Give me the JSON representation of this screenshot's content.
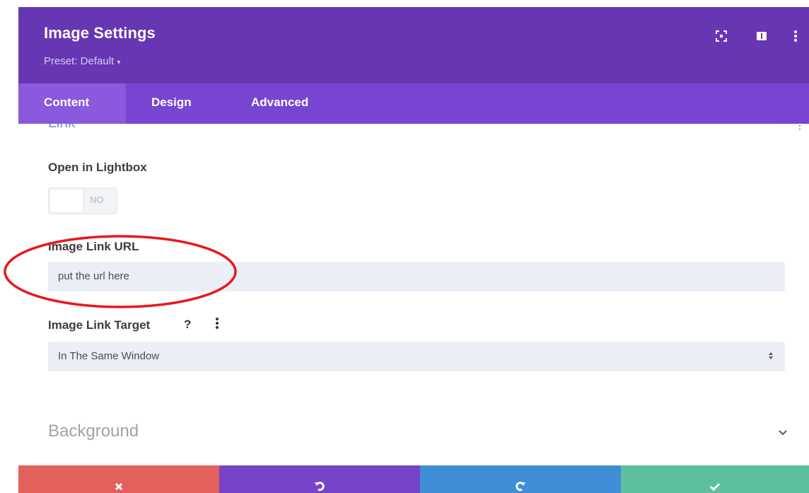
{
  "header": {
    "title": "Image Settings",
    "preset": "Preset: Default",
    "bg_color": "#6736b3"
  },
  "tabs": [
    {
      "label": "Content",
      "active": true
    },
    {
      "label": "Design",
      "active": false
    },
    {
      "label": "Advanced",
      "active": false
    }
  ],
  "sections": {
    "link_title": "Link",
    "background_title": "Background"
  },
  "fields": {
    "lightbox_label": "Open in Lightbox",
    "lightbox_value": "NO",
    "url_label": "Image Link URL",
    "url_value": "put the url here",
    "target_label": "Image Link Target",
    "target_value": "In The Same Window",
    "target_help": "?"
  },
  "annotation": {
    "shape": "ellipse",
    "color": "#e8181c"
  },
  "footer": {
    "cancel_color": "#e2625b",
    "undo_color": "#7743c8",
    "redo_color": "#418ed7",
    "save_color": "#5dbf9e"
  }
}
